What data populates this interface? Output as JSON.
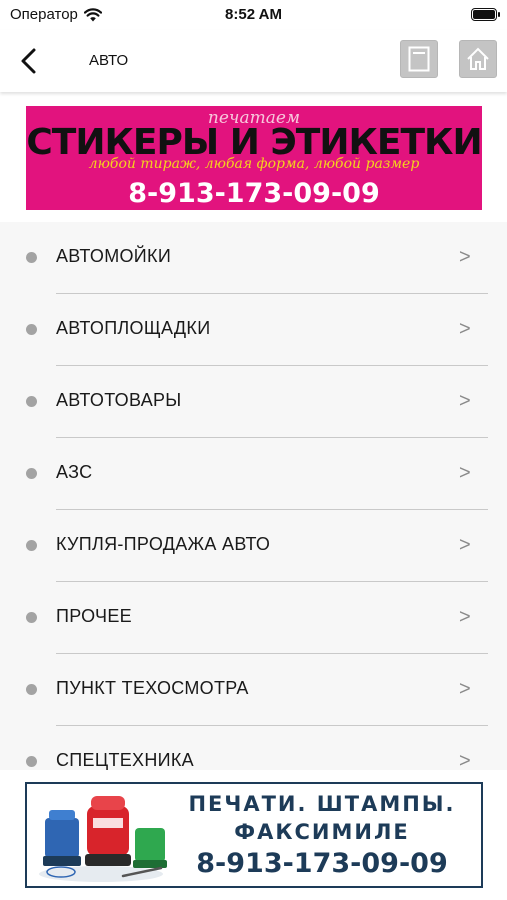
{
  "status_bar": {
    "carrier": "Оператор",
    "time": "8:52 AM"
  },
  "nav": {
    "title": "АВТО",
    "back_icon": "chevron-left-icon",
    "page_icon": "document-icon",
    "home_icon": "home-icon"
  },
  "banner_top": {
    "small_text": "печатаем",
    "headline": "СТИКЕРЫ И ЭТИКЕТКИ",
    "script_text": "любой тираж, любая форма, любой размер",
    "phone": "8-913-173-09-09",
    "background": "#e2137e"
  },
  "categories": [
    {
      "label": "АВТОМОЙКИ",
      "chevron": ">"
    },
    {
      "label": "АВТОПЛОЩАДКИ",
      "chevron": ">"
    },
    {
      "label": "АВТОТОВАРЫ",
      "chevron": ">"
    },
    {
      "label": "АЗС",
      "chevron": ">"
    },
    {
      "label": "КУПЛЯ-ПРОДАЖА АВТО",
      "chevron": ">"
    },
    {
      "label": "ПРОЧЕЕ",
      "chevron": ">"
    },
    {
      "label": "ПУНКТ ТЕХОСМОТРА",
      "chevron": ">"
    },
    {
      "label": "СПЕЦТЕХНИКА",
      "chevron": ">"
    }
  ],
  "banner_bottom": {
    "line1": "ПЕЧАТИ. ШТАМПЫ.",
    "line2": "ФАКСИМИЛЕ",
    "phone": "8-913-173-09-09",
    "accent": "#1d3b58"
  }
}
